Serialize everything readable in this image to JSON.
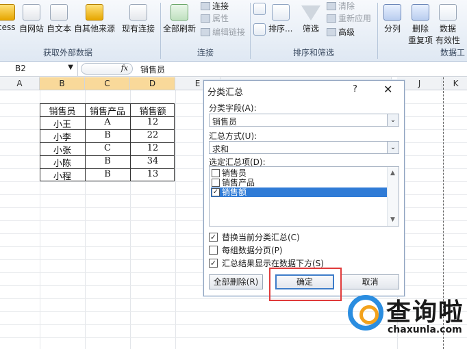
{
  "ribbon": {
    "buttons": {
      "access": "cess",
      "web": "自网站",
      "text": "自文本",
      "other": "自其他来源",
      "existing": "现有连接",
      "refresh_all": "全部刷新",
      "sort": "排序...",
      "filter": "筛选",
      "text_to_columns": "分列",
      "remove_dup_line1": "删除",
      "remove_dup_line2": "重复项",
      "validation_line1": "数据",
      "validation_line2": "有效性"
    },
    "small_items": {
      "connections": "连接",
      "properties": "属性",
      "edit_links": "编辑链接",
      "clear": "清除",
      "reapply": "重新应用",
      "advanced": "高级"
    },
    "groups": {
      "get_external": "获取外部数据",
      "connections": "连接",
      "sort_filter": "排序和筛选",
      "data_tools": "数据工"
    }
  },
  "formula_bar": {
    "name_box": "B2",
    "fx": "fx",
    "value": "销售员"
  },
  "columns": [
    "A",
    "B",
    "C",
    "D",
    "E",
    "J",
    "K"
  ],
  "table": {
    "headers": [
      "销售员",
      "销售产品",
      "销售额"
    ],
    "rows": [
      [
        "小王",
        "A",
        "12"
      ],
      [
        "小李",
        "B",
        "22"
      ],
      [
        "小张",
        "C",
        "12"
      ],
      [
        "小陈",
        "B",
        "34"
      ],
      [
        "小程",
        "B",
        "13"
      ]
    ]
  },
  "dialog": {
    "title": "分类汇总",
    "help": "?",
    "close": "✕",
    "group_by_label": "分类字段(A):",
    "group_by_value": "销售员",
    "function_label": "汇总方式(U):",
    "function_value": "求和",
    "add_to_label": "选定汇总项(D):",
    "add_to_items": [
      {
        "label": "销售员",
        "checked": false
      },
      {
        "label": "销售产品",
        "checked": false
      },
      {
        "label": "销售额",
        "checked": true
      }
    ],
    "options": [
      {
        "label": "替换当前分类汇总(C)",
        "checked": true
      },
      {
        "label": "每组数据分页(P)",
        "checked": false
      },
      {
        "label": "汇总结果显示在数据下方(S)",
        "checked": true
      }
    ],
    "remove_all": "全部删除(R)",
    "ok": "确定",
    "cancel": "取消"
  },
  "watermark": {
    "text": "查询啦",
    "url": "chaxunla.com"
  },
  "colors": {
    "selected_header": "#f9d99a",
    "selection_blue": "#2f7bd6",
    "highlight_red": "#e03a3a",
    "logo_blue": "#2a8de0",
    "logo_orange": "#f3a21c"
  }
}
